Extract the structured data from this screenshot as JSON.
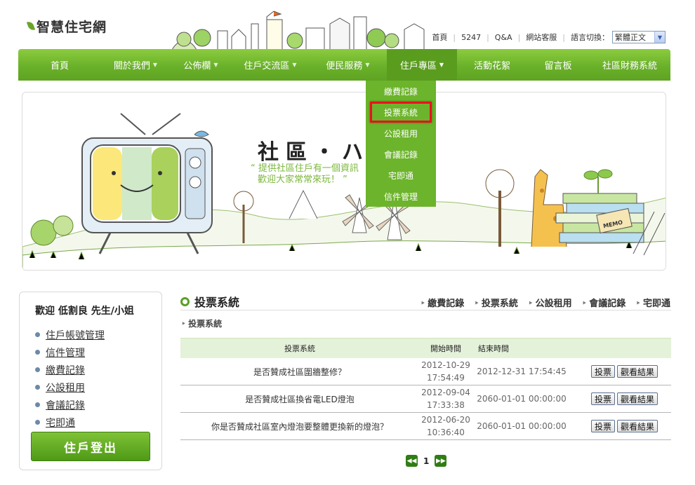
{
  "site": {
    "logo_text": "智慧住宅網"
  },
  "toplinks": {
    "items": [
      "首頁",
      "5247",
      "Q&A",
      "網站客服"
    ],
    "lang_label": "語言切換：",
    "lang_value": "繁體正文"
  },
  "nav": {
    "items": [
      "首頁",
      "關於我們",
      "公佈欄",
      "住戶交流區",
      "便民服務",
      "住戶專區",
      "活動花絮",
      "留言板",
      "社區財務系統"
    ]
  },
  "dropdown": {
    "items": [
      "繳費記錄",
      "投票系統",
      "公設租用",
      "會議記錄",
      "宅即通",
      "信件管理"
    ]
  },
  "banner": {
    "title": "社區・ハ",
    "quote_line1": "“ 提供社區住戶有一個資訊",
    "quote_line2": "歡迎大家常常來玩！ ”",
    "memo": "MEMO"
  },
  "sidebar": {
    "welcome": "歡迎 低割良 先生/小姐",
    "links": [
      "住戶帳號管理",
      "信件管理",
      "繳費記錄",
      "公設租用",
      "會議記錄",
      "宅即通"
    ],
    "login_button": "住戶登出"
  },
  "content": {
    "title": "投票系統",
    "sub_links": [
      "繳費記錄",
      "投票系統",
      "公設租用",
      "會議記錄",
      "宅即通"
    ],
    "breadcrumb": "投票系統",
    "table": {
      "headers": [
        "投票系統",
        "開始時間",
        "結束時間"
      ],
      "rows": [
        {
          "question": "是否贊成社區圍牆整修？",
          "start_date": "2012-10-29",
          "start_time": "17:54:49",
          "end": "2012-12-31 17:54:45"
        },
        {
          "question": "是否贊成社區換省電LED燈泡",
          "start_date": "2012-09-04",
          "start_time": "17:33:38",
          "end": "2060-01-01 00:00:00"
        },
        {
          "question": "你是否贊成社區室內燈泡要整體更換新的燈泡？",
          "start_date": "2012-06-20",
          "start_time": "10:36:40",
          "end": "2060-01-01 00:00:00"
        }
      ],
      "vote_label": "投票",
      "result_label": "觀看結果"
    },
    "pager": {
      "current": "1",
      "prev_icon": "double-left-arrow-icon",
      "next_icon": "double-right-arrow-icon"
    }
  },
  "colors": {
    "nav_green": "#6ab12a",
    "dropdown_green": "#6cb42b",
    "highlight_red": "#e8121e",
    "table_head": "#e5f2da"
  }
}
